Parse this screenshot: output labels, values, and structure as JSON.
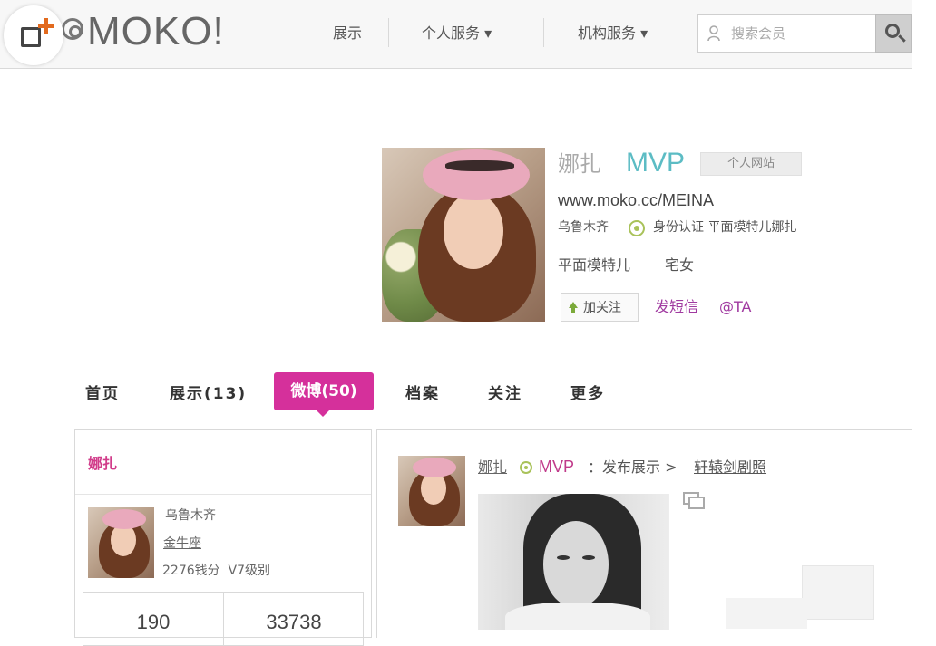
{
  "header": {
    "logo_text": "MOKO!",
    "nav": [
      "展示",
      "个人服务 ▾",
      "机构服务 ▾"
    ],
    "search_placeholder": "搜索会员"
  },
  "profile": {
    "name": "娜扎",
    "badge": "MVP",
    "site_button": "个人网站",
    "url": "www.moko.cc/MEINA",
    "city": "乌鲁木齐",
    "verification": "身份认证 平面模特儿娜扎",
    "tags": [
      "平面模特儿",
      "宅女"
    ],
    "follow_button": "加关注",
    "message_link": "发短信",
    "at_link": "@TA"
  },
  "tabs": [
    "首页",
    "展示(13)",
    "微博(50)",
    "档案",
    "关注",
    "更多"
  ],
  "sidebar": {
    "title": "娜扎",
    "city": "乌鲁木齐",
    "zodiac": "金牛座",
    "points": "2276钱分",
    "level": "V7级别",
    "stats": [
      "190",
      "33738"
    ]
  },
  "feed": {
    "name": "娜扎",
    "badge": "MVP",
    "action": "：发布展示 >",
    "album": "轩辕剑剧照"
  },
  "colors": {
    "accent_pink": "#d5309b",
    "mvp_teal": "#5cbcc4",
    "verify_green": "#a9c25a"
  }
}
